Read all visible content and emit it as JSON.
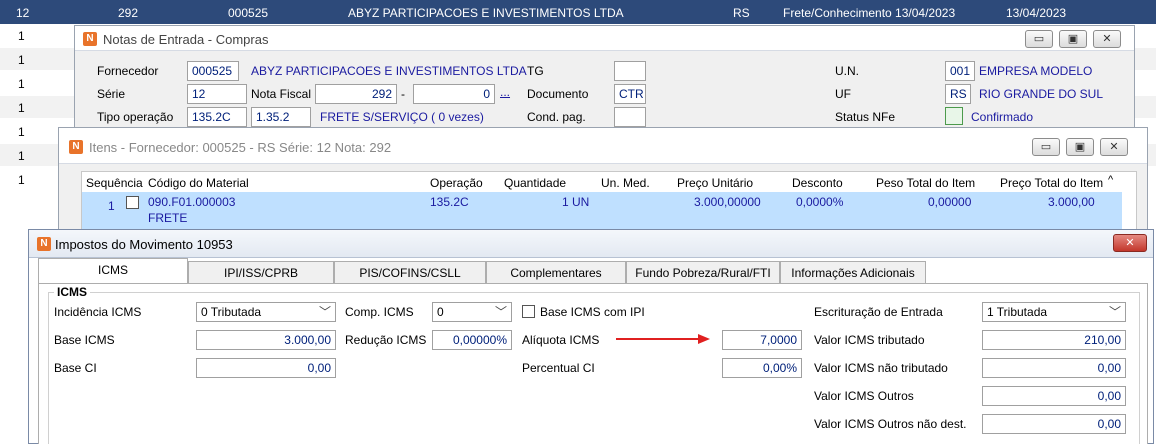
{
  "bg_table": {
    "header": {
      "c1": "12",
      "c2": "292",
      "c3": "000525",
      "c4": "ABYZ PARTICIPACOES E INVESTIMENTOS LTDA",
      "c5": "RS",
      "c6": "Frete/Conhecimento  13/04/2023",
      "c7": "13/04/2023"
    },
    "rows": [
      "1",
      "1",
      "1",
      "1",
      "1",
      "1",
      "1"
    ]
  },
  "notas_window": {
    "title": "Notas de Entrada - Compras",
    "fornecedor_label": "Fornecedor",
    "fornecedor_code": "000525",
    "fornecedor_name": "ABYZ PARTICIPACOES E INVESTIMENTOS LTDA",
    "tg_label": "TG",
    "un_label": "U.N.",
    "un_code": "001",
    "un_name": "EMPRESA MODELO",
    "serie_label": "Série",
    "serie_value": "12",
    "nota_fiscal_label": "Nota Fiscal",
    "nota_fiscal_value": "292",
    "nota_dash": "-",
    "nota_seq": "0",
    "nota_dots": "...",
    "documento_label": "Documento",
    "documento_value": "CTR",
    "uf_label": "UF",
    "uf_code": "RS",
    "uf_name": "RIO GRANDE DO SUL",
    "tipo_op_label": "Tipo operação",
    "tipo_op_code": "135.2C",
    "tipo_op_code2": "1.35.2",
    "tipo_op_desc": "FRETE S/SERVIÇO ( 0 vezes)",
    "cond_pag_label": "Cond. pag.",
    "status_nfe_label": "Status NFe",
    "status_nfe_value": "Confirmado"
  },
  "itens_window": {
    "title": "Itens - Fornecedor: 000525 - RS Série: 12   Nota: 292",
    "columns": [
      "Sequência",
      "Código do Material",
      "Operação",
      "Quantidade",
      "Un. Med.",
      "Preço Unitário",
      "Desconto",
      "Peso Total do Item",
      "Preço Total do Item"
    ],
    "row": {
      "seq": "1",
      "material": "090.F01.000003",
      "material_desc": "FRETE",
      "operacao": "135.2C",
      "quantidade": "1 UN",
      "preco_unit": "3.000,00000",
      "desconto": "0,0000%",
      "peso": "0,00000",
      "preco_total": "3.000,00"
    }
  },
  "impostos_window": {
    "title": "Impostos do Movimento 10953",
    "close_label": "✕",
    "tabs": [
      "ICMS",
      "IPI/ISS/CPRB",
      "PIS/COFINS/CSLL",
      "Complementares",
      "Fundo Pobreza/Rural/FTI",
      "Informações Adicionais"
    ],
    "group_label": "ICMS",
    "incidencia_label": "Incidência ICMS",
    "incidencia_value": "0 Tributada",
    "comp_icms_label": "Comp. ICMS",
    "comp_icms_value": "0",
    "base_ipi_label": "Base ICMS com IPI",
    "escrituracao_label": "Escrituração de Entrada",
    "escrituracao_value": "1 Tributada",
    "base_icms_label": "Base ICMS",
    "base_icms_value": "3.000,00",
    "reducao_label": "Redução ICMS",
    "reducao_value": "0,00000%",
    "aliquota_label": "Alíquota ICMS",
    "aliquota_value": "7,0000",
    "valor_trib_label": "Valor ICMS tributado",
    "valor_trib_value": "210,00",
    "base_ci_label": "Base CI",
    "base_ci_value": "0,00",
    "percentual_ci_label": "Percentual CI",
    "percentual_ci_value": "0,00%",
    "valor_nao_trib_label": "Valor ICMS não tributado",
    "valor_nao_trib_value": "0,00",
    "valor_outros_label": "Valor ICMS Outros",
    "valor_outros_value": "0,00",
    "valor_outros_nd_label": "Valor ICMS Outros não dest.",
    "valor_outros_nd_value": "0,00"
  },
  "colors": {
    "header_blue": "#2d4a7a",
    "selection": "#bfe0ff",
    "arrow_red": "#e02020",
    "close_red": "#c9443b"
  }
}
